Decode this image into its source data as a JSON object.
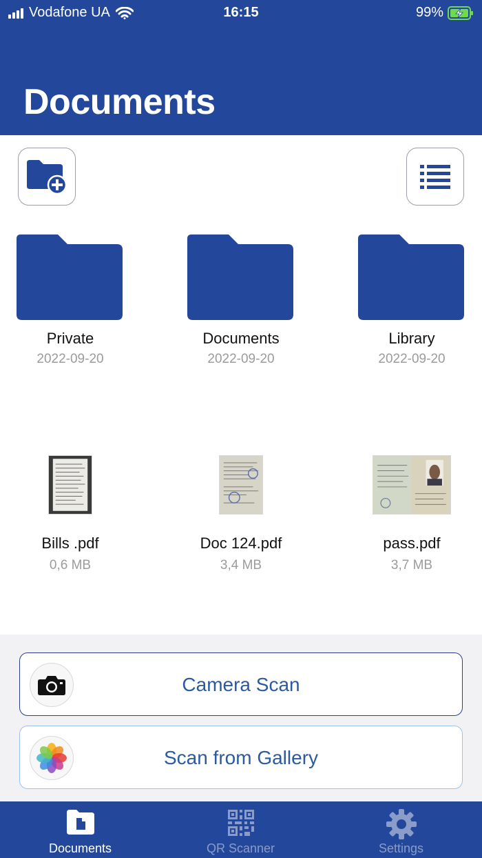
{
  "status_bar": {
    "carrier": "Vodafone UA",
    "time": "16:15",
    "battery": "99%"
  },
  "header": {
    "title": "Documents"
  },
  "toolbar": {
    "new_folder_icon": "folder-plus-icon",
    "view_icon": "list-view-icon"
  },
  "folders": [
    {
      "name": "Private",
      "date": "2022-09-20"
    },
    {
      "name": "Documents",
      "date": "2022-09-20"
    },
    {
      "name": "Library",
      "date": "2022-09-20"
    }
  ],
  "files": [
    {
      "name": "Bills .pdf",
      "size": "0,6 MB"
    },
    {
      "name": "Doc 124.pdf",
      "size": "3,4 MB"
    },
    {
      "name": "pass.pdf",
      "size": "3,7 MB"
    }
  ],
  "scan": {
    "camera_label": "Camera Scan",
    "gallery_label": "Scan from Gallery"
  },
  "tabs": [
    {
      "label": "Documents",
      "active": true
    },
    {
      "label": "QR Scanner",
      "active": false
    },
    {
      "label": "Settings",
      "active": false
    }
  ],
  "colors": {
    "brand": "#23479a",
    "accent_text": "#2c5aa0"
  }
}
